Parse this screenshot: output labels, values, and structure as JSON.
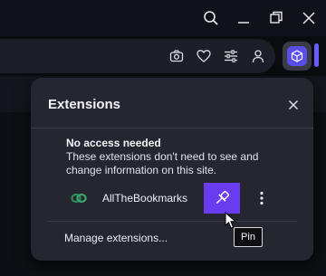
{
  "popup": {
    "title": "Extensions",
    "section_heading": "No access needed",
    "section_description": "These extensions don't need to see and change information on this site.",
    "extensions": [
      {
        "name": "AllTheBookmarks",
        "icon": "link-chain-icon"
      }
    ],
    "manage_label": "Manage extensions..."
  },
  "tooltip": {
    "text": "Pin"
  },
  "colors": {
    "accent": "#6a3cf0",
    "popup_bg": "#25262f",
    "extension_icon": "#2e8b57"
  }
}
